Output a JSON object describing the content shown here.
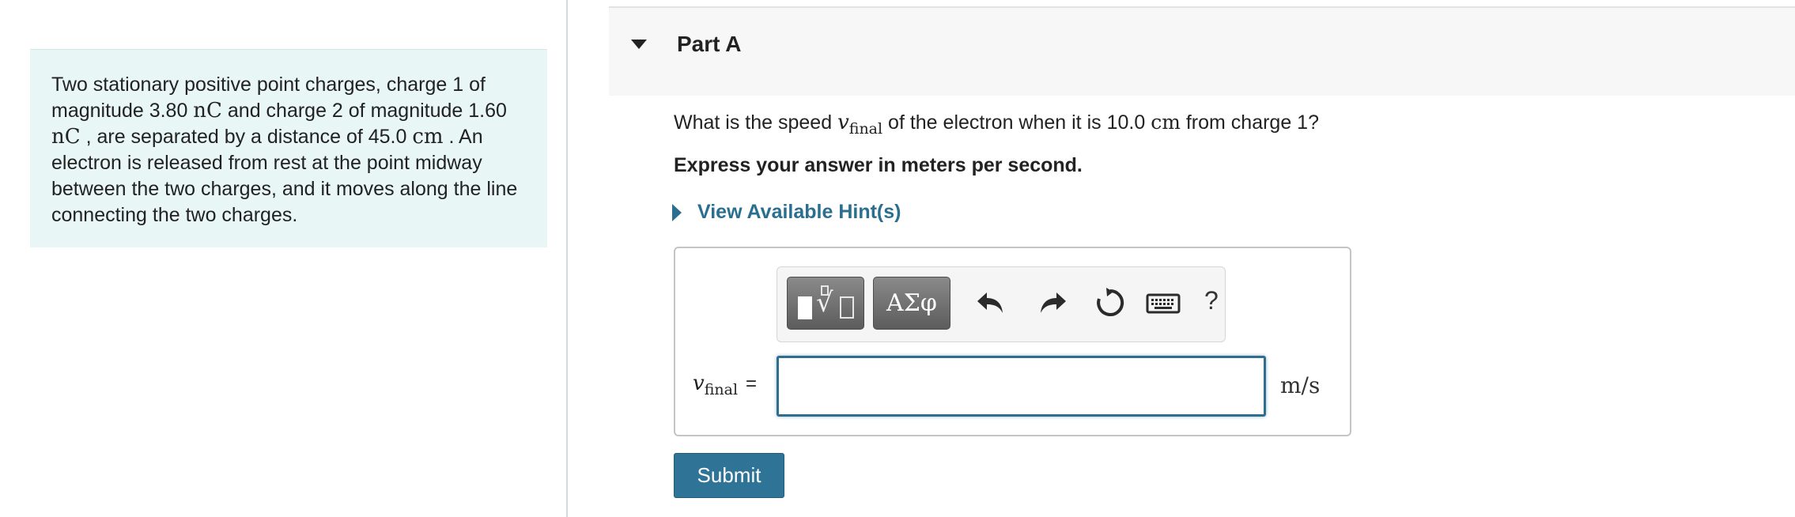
{
  "problem": {
    "text_1": "Two stationary positive point charges, charge 1 of magnitude 3.80 ",
    "unit_nc_1": "nC",
    "text_2": " and charge 2 of magnitude 1.60 ",
    "unit_nc_2": "nC",
    "text_3": " , are separated by a distance of 45.0 ",
    "unit_cm": "cm",
    "text_4": " . An electron is released from rest at the point midway between the two charges, and it moves along the line connecting the two charges."
  },
  "part": {
    "title": "Part A"
  },
  "question": {
    "text_before": "What is the speed ",
    "var": "v",
    "var_sub": "final",
    "text_middle": " of the electron when it is 10.0 ",
    "unit": "cm",
    "text_after": " from charge 1?"
  },
  "instruction": "Express your answer in meters per second.",
  "hint": {
    "label": "View Available Hint(s)"
  },
  "toolbar": {
    "greek_label": "ΑΣφ",
    "help_label": "?",
    "icons": [
      "templates-icon",
      "undo-icon",
      "redo-icon",
      "reset-icon",
      "keyboard-icon",
      "help-icon"
    ]
  },
  "answer": {
    "var": "v",
    "var_sub": "final",
    "equals": "=",
    "value": "",
    "unit": "m/s"
  },
  "submit_label": "Submit",
  "colors": {
    "accent": "#2f7397",
    "hint_link": "#2a6e90",
    "problem_bg": "#e8f6f5"
  }
}
